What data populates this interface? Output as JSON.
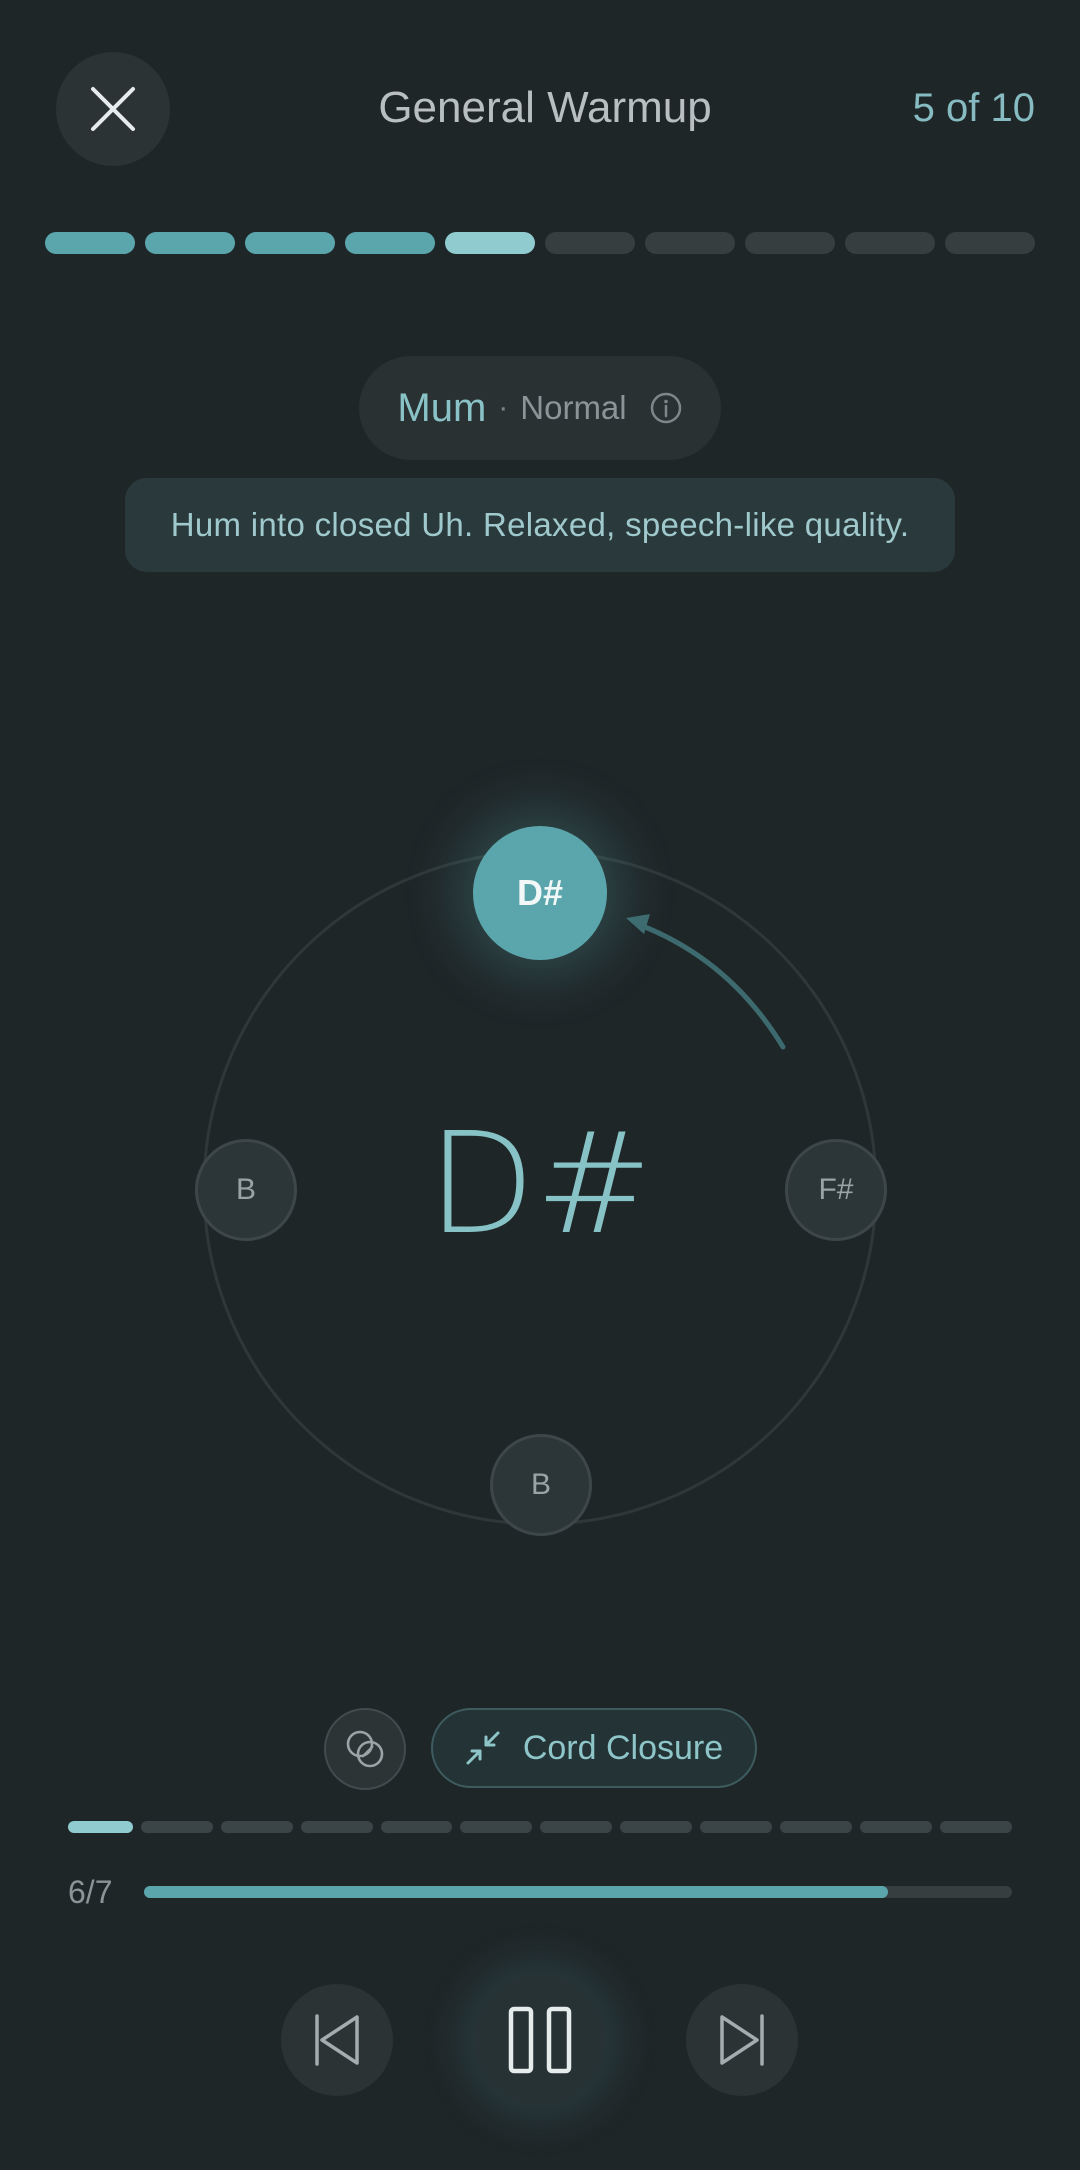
{
  "header": {
    "title": "General Warmup",
    "step_counter": "5 of 10",
    "close_icon": "close-icon"
  },
  "steps": {
    "total": 10,
    "completed": 4,
    "current_index": 4
  },
  "exercise": {
    "name": "Mum",
    "separator": "·",
    "mode": "Normal",
    "info_icon": "info-icon",
    "instruction": "Hum into closed Uh. Relaxed, speech-like quality."
  },
  "wheel": {
    "current_note": "D#",
    "notes": {
      "top": "D#",
      "right": "F#",
      "bottom": "B",
      "left": "B"
    },
    "direction_icon": "arrow-curve-icon"
  },
  "controls": {
    "mix_icon": "overlap-circles-icon",
    "cord_icon": "compress-arrows-icon",
    "cord_label": "Cord Closure"
  },
  "reps": {
    "segments": 12,
    "current_segment": 1,
    "counter": "6/7",
    "progress": 0.857
  },
  "transport": {
    "prev_icon": "skip-previous-icon",
    "pause_icon": "pause-icon",
    "next_icon": "skip-next-icon"
  },
  "colors": {
    "background": "#1f2628",
    "accent": "#5ba6ac",
    "accent_light": "#8fcbcf"
  }
}
